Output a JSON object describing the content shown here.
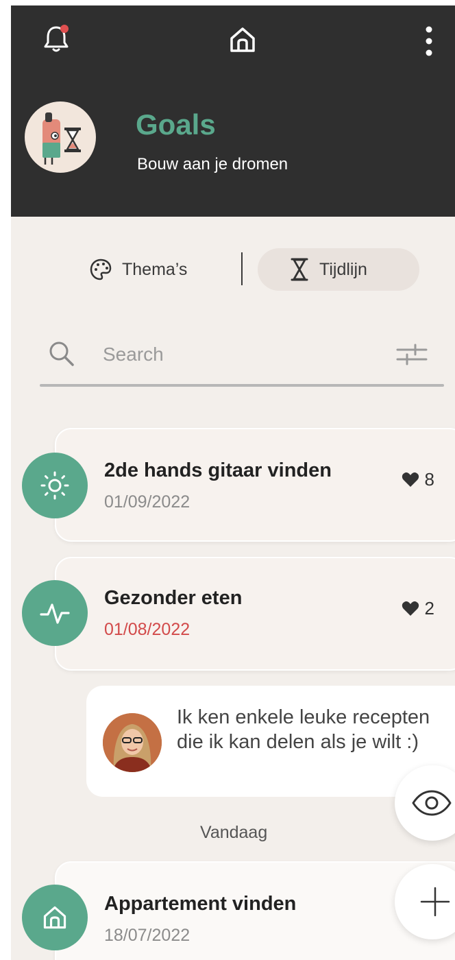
{
  "header": {
    "title": "Goals",
    "subtitle": "Bouw aan je dromen",
    "notification_dot_color": "#e05050",
    "icons": [
      "bell-icon",
      "home-icon",
      "more-vertical-icon"
    ]
  },
  "segments": {
    "themes_label": "Thema’s",
    "timeline_label": "Tijdlijn",
    "selected": "Tijdlijn"
  },
  "search": {
    "placeholder": "Search",
    "value": ""
  },
  "goals": [
    {
      "title": "2de hands gitaar vinden",
      "date": "01/09/2022",
      "likes": "8",
      "icon": "sun-icon",
      "overdue": false
    },
    {
      "title": "Gezonder eten",
      "date": "01/08/2022",
      "likes": "2",
      "icon": "pulse-icon",
      "overdue": true
    },
    {
      "title": "Appartement vinden",
      "date": "18/07/2022",
      "icon": "home-icon",
      "overdue": false
    }
  ],
  "comment": {
    "text": "Ik ken enkele leuke recepten die ik kan delen als je wilt :)"
  },
  "timeline_divider": "Vandaag",
  "colors": {
    "header_bg": "#2f2f2f",
    "accent": "#5aa88c",
    "background": "#f3efeb",
    "overdue": "#d24a4a"
  }
}
